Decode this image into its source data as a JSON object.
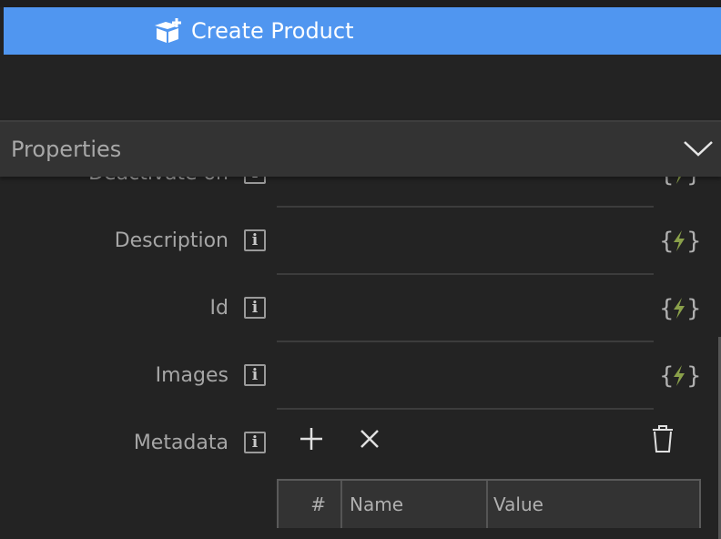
{
  "action": {
    "label": "Create Product",
    "icon": "box-add-icon"
  },
  "panel": {
    "title": "Properties",
    "toggle_icon": "chevron-down-icon"
  },
  "properties": [
    {
      "label": "Deactivate on",
      "info_icon": "info-icon",
      "bind_icon": "dynamic-value-icon"
    },
    {
      "label": "Description",
      "info_icon": "info-icon",
      "bind_icon": "dynamic-value-icon"
    },
    {
      "label": "Id",
      "info_icon": "info-icon",
      "bind_icon": "dynamic-value-icon"
    },
    {
      "label": "Images",
      "info_icon": "info-icon",
      "bind_icon": "dynamic-value-icon"
    }
  ],
  "metadata": {
    "label": "Metadata",
    "columns": [
      "#",
      "Name",
      "Value"
    ],
    "rows": []
  },
  "colors": {
    "accent": "#5096f0",
    "bolt": "#8aa04a",
    "background": "#232323"
  }
}
